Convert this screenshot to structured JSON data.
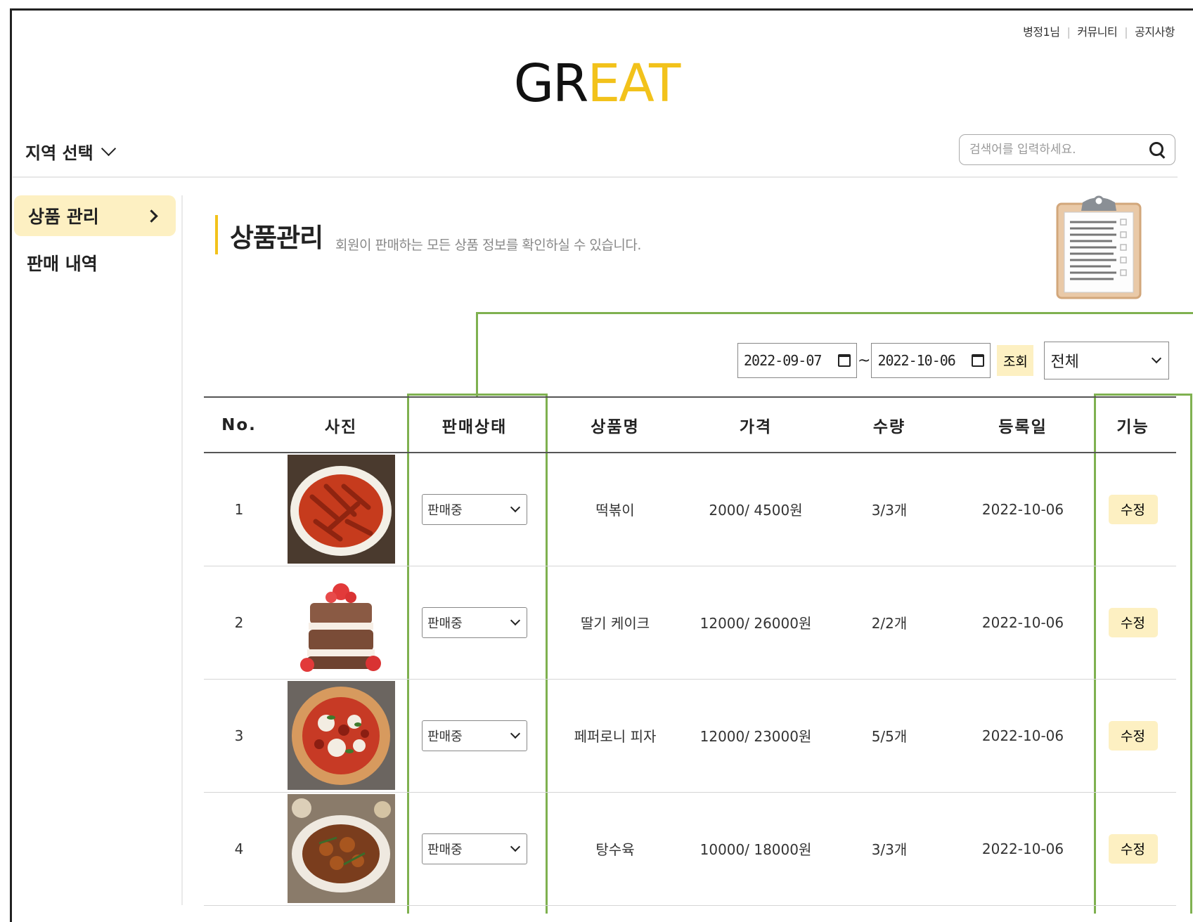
{
  "header": {
    "top_links": [
      "병정1님",
      "커뮤니티",
      "공지사항"
    ],
    "logo_part1": "GR",
    "logo_part2": "EAT",
    "region_label": "지역 선택",
    "search_placeholder": "검색어를 입력하세요."
  },
  "sidebar": {
    "items": [
      {
        "label": "상품 관리",
        "active": true
      },
      {
        "label": "판매 내역",
        "active": false
      }
    ]
  },
  "main": {
    "title": "상품관리",
    "description": "회원이 판매하는 모든 상품 정보를 확인하실 수 있습니다.",
    "filter": {
      "start_date": "2022-09-07",
      "separator": "~",
      "end_date": "2022-10-06",
      "query_label": "조회",
      "status_filter": "전체"
    },
    "table": {
      "columns": [
        "No.",
        "사진",
        "판매상태",
        "상품명",
        "가격",
        "수량",
        "등록일",
        "기능"
      ],
      "rows": [
        {
          "no": "1",
          "photo": "tteokbokki",
          "status": "판매중",
          "name": "떡볶이",
          "price": "2000/ 4500원",
          "qty": "3/3개",
          "date": "2022-10-06",
          "action": "수정"
        },
        {
          "no": "2",
          "photo": "strawberry-cake",
          "status": "판매중",
          "name": "딸기 케이크",
          "price": "12000/ 26000원",
          "qty": "2/2개",
          "date": "2022-10-06",
          "action": "수정"
        },
        {
          "no": "3",
          "photo": "pepperoni-pizza",
          "status": "판매중",
          "name": "페퍼로니 피자",
          "price": "12000/ 23000원",
          "qty": "5/5개",
          "date": "2022-10-06",
          "action": "수정"
        },
        {
          "no": "4",
          "photo": "tangsuyuk",
          "status": "판매중",
          "name": "탕수육",
          "price": "10000/ 18000원",
          "qty": "3/3개",
          "date": "2022-10-06",
          "action": "수정"
        }
      ]
    }
  },
  "colors": {
    "accent": "#f2c21b",
    "accent_light": "#fdf0c2",
    "highlight_green": "#7fb150"
  }
}
